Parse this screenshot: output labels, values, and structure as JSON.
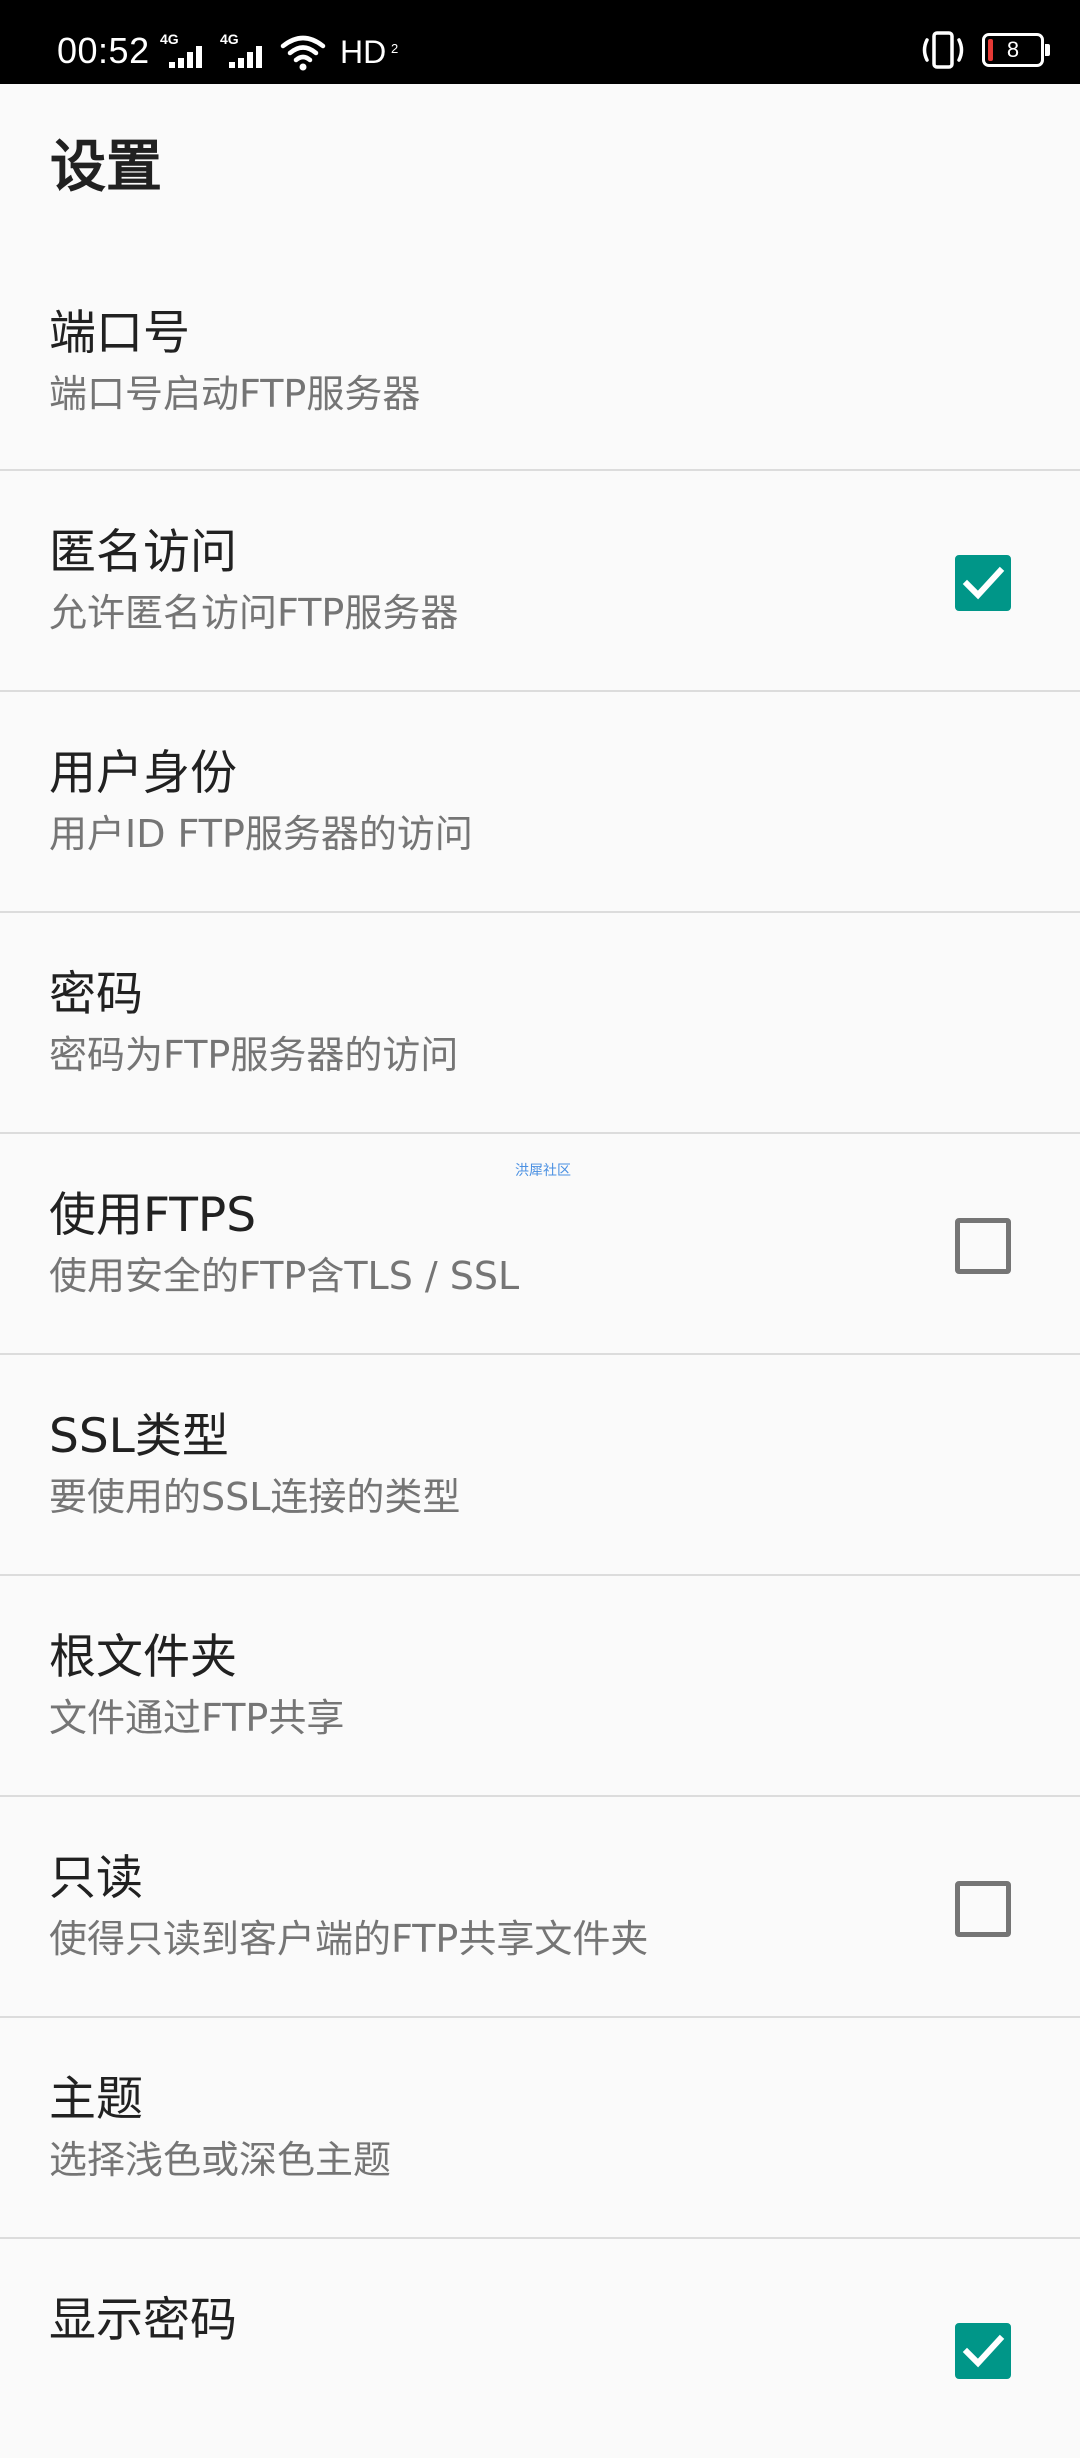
{
  "status_bar": {
    "time": "00:52",
    "signal_1_label": "4G",
    "signal_2_label": "4G",
    "hd_label": "HD",
    "hd_sub": "2",
    "battery_level": "8",
    "icons": [
      "signal-icon",
      "signal-icon",
      "wifi-icon",
      "hd-icon",
      "vibrate-icon",
      "battery-icon"
    ]
  },
  "page": {
    "title": "设置"
  },
  "preferences": [
    {
      "title": "端口号",
      "summary": "端口号启动FTP服务器",
      "has_checkbox": false
    },
    {
      "title": "匿名访问",
      "summary": "允许匿名访问FTP服务器",
      "has_checkbox": true,
      "checked": true
    },
    {
      "title": "用户身份",
      "summary": "用户ID FTP服务器的访问",
      "has_checkbox": false
    },
    {
      "title": "密码",
      "summary": "密码为FTP服务器的访问",
      "has_checkbox": false
    },
    {
      "title": "使用FTPS",
      "summary": "使用安全的FTP含TLS / SSL",
      "has_checkbox": true,
      "checked": false
    },
    {
      "title": "SSL类型",
      "summary": "要使用的SSL连接的类型",
      "has_checkbox": false
    },
    {
      "title": "根文件夹",
      "summary": "文件通过FTP共享",
      "has_checkbox": false
    },
    {
      "title": "只读",
      "summary": "使得只读到客户端的FTP共享文件夹",
      "has_checkbox": true,
      "checked": false
    },
    {
      "title": "主题",
      "summary": "选择浅色或深色主题",
      "has_checkbox": false
    },
    {
      "title": "显示密码",
      "summary": "",
      "has_checkbox": true,
      "checked": true
    }
  ],
  "watermark": "洪犀社区",
  "colors": {
    "accent": "#009688",
    "status_bar_bg": "#000000",
    "background": "#fafafa",
    "title_text": "#212121",
    "summary_text": "#757575",
    "divider": "#dcdcdc",
    "battery_low": "#e53935"
  }
}
